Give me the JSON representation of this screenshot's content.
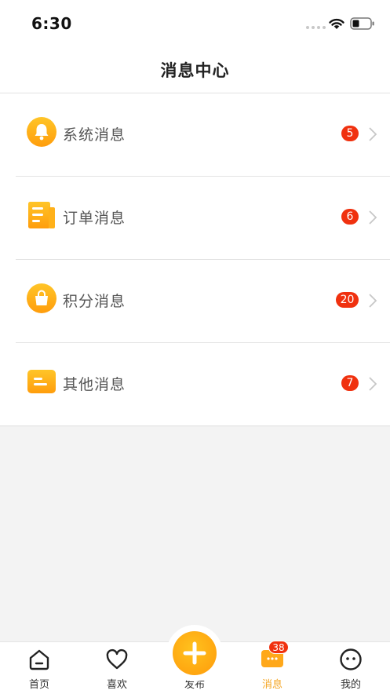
{
  "status_bar": {
    "time": "6:30"
  },
  "nav": {
    "title": "消息中心"
  },
  "messages": [
    {
      "label": "系统消息",
      "badge": "5",
      "icon": "bell-icon"
    },
    {
      "label": "订单消息",
      "badge": "6",
      "icon": "order-doc-icon"
    },
    {
      "label": "积分消息",
      "badge": "20",
      "icon": "points-bag-icon"
    },
    {
      "label": "其他消息",
      "badge": "7",
      "icon": "other-chat-icon"
    }
  ],
  "tabs": [
    {
      "label": "首页",
      "icon": "home-icon"
    },
    {
      "label": "喜欢",
      "icon": "heart-icon"
    },
    {
      "label": "发布",
      "icon": "plus-icon"
    },
    {
      "label": "消息",
      "icon": "message-icon",
      "badge": "38",
      "active": true
    },
    {
      "label": "我的",
      "icon": "profile-face-icon"
    }
  ],
  "colors": {
    "accent": "#f5a623",
    "badge": "#f0310f",
    "background": "#f3f3f3"
  }
}
